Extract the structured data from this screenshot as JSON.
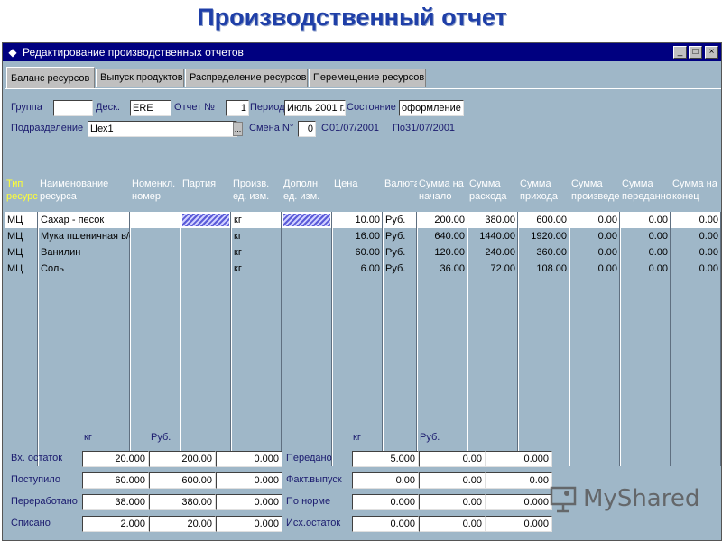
{
  "slide_title": "Производственный отчет",
  "window": {
    "title": "Редактирование производственных отчетов",
    "buttons": {
      "minimize": "_",
      "maximize": "□",
      "close": "×"
    }
  },
  "tabs": [
    {
      "label": "Баланс ресурсов",
      "active": true
    },
    {
      "label": "Выпуск продуктов",
      "active": false
    },
    {
      "label": "Распределение ресурсов",
      "active": false
    },
    {
      "label": "Перемещение ресурсов",
      "active": false
    }
  ],
  "header": {
    "group_label": "Группа",
    "group_value": "",
    "desk_label": "Деск.",
    "desk_value": "ERE",
    "report_label": "Отчет №",
    "report_value": "1",
    "period_label": "Период",
    "period_value": "Июль 2001 г.",
    "state_label": "Состояние",
    "state_value": "оформление",
    "subdivision_label": "Подразделение",
    "subdivision_value": "Цех1",
    "ellipsis": "...",
    "shift_label": "Смена N°",
    "shift_value": "0",
    "from_label": "С",
    "from_value": "01/07/2001",
    "to_label": "По",
    "to_value": "31/07/2001"
  },
  "grid": {
    "columns": [
      "Тип ресурс",
      "Наименование ресурса",
      "Номенкл. номер",
      "Партия",
      "Произв. ед. изм.",
      "Дополн. ед. изм.",
      "Цена",
      "Валюта",
      "Сумма на начало",
      "Сумма расхода",
      "Сумма прихода",
      "Сумма произведе",
      "Сумма переданно",
      "Сумма на конец"
    ],
    "rows": [
      {
        "type": "МЦ",
        "name": "Сахар - песок",
        "nom": "",
        "batch": "",
        "unit": "кг",
        "unit2": "",
        "price": "10.00",
        "currency": "Руб.",
        "start": "200.00",
        "expense": "380.00",
        "income": "600.00",
        "produced": "0.00",
        "transferred": "0.00",
        "end": "0.00"
      },
      {
        "type": "МЦ",
        "name": "Мука пшеничная в/с",
        "nom": "",
        "batch": "",
        "unit": "кг",
        "unit2": "",
        "price": "16.00",
        "currency": "Руб.",
        "start": "640.00",
        "expense": "1440.00",
        "income": "1920.00",
        "produced": "0.00",
        "transferred": "0.00",
        "end": "0.00"
      },
      {
        "type": "МЦ",
        "name": "Ванилин",
        "nom": "",
        "batch": "",
        "unit": "кг",
        "unit2": "",
        "price": "60.00",
        "currency": "Руб.",
        "start": "120.00",
        "expense": "240.00",
        "income": "360.00",
        "produced": "0.00",
        "transferred": "0.00",
        "end": "0.00"
      },
      {
        "type": "МЦ",
        "name": "Соль",
        "nom": "",
        "batch": "",
        "unit": "кг",
        "unit2": "",
        "price": "6.00",
        "currency": "Руб.",
        "start": "36.00",
        "expense": "72.00",
        "income": "108.00",
        "produced": "0.00",
        "transferred": "0.00",
        "end": "0.00"
      }
    ]
  },
  "summary": {
    "left": {
      "unit_kg": "кг",
      "unit_rub": "Руб.",
      "rows": [
        {
          "label": "Вх. остаток",
          "kg": "20.000",
          "rub": "200.00",
          "extra": "0.000"
        },
        {
          "label": "Поступило",
          "kg": "60.000",
          "rub": "600.00",
          "extra": "0.000"
        },
        {
          "label": "Переработано",
          "kg": "38.000",
          "rub": "380.00",
          "extra": "0.000"
        },
        {
          "label": "Списано",
          "kg": "2.000",
          "rub": "20.00",
          "extra": "0.000"
        }
      ]
    },
    "right": {
      "unit_kg": "кг",
      "unit_rub": "Руб.",
      "rows": [
        {
          "label": "Передано",
          "kg": "5.000",
          "rub": "0.00",
          "extra": "0.000"
        },
        {
          "label": "Факт.выпуск",
          "kg": "0.00",
          "rub": "0.00",
          "extra": "0.00"
        },
        {
          "label": "По норме",
          "kg": "0.000",
          "rub": "0.00",
          "extra": "0.000"
        },
        {
          "label": "Исх.остаток",
          "kg": "0.000",
          "rub": "0.00",
          "extra": "0.000"
        }
      ]
    }
  },
  "watermark": {
    "text": "MyShared"
  }
}
